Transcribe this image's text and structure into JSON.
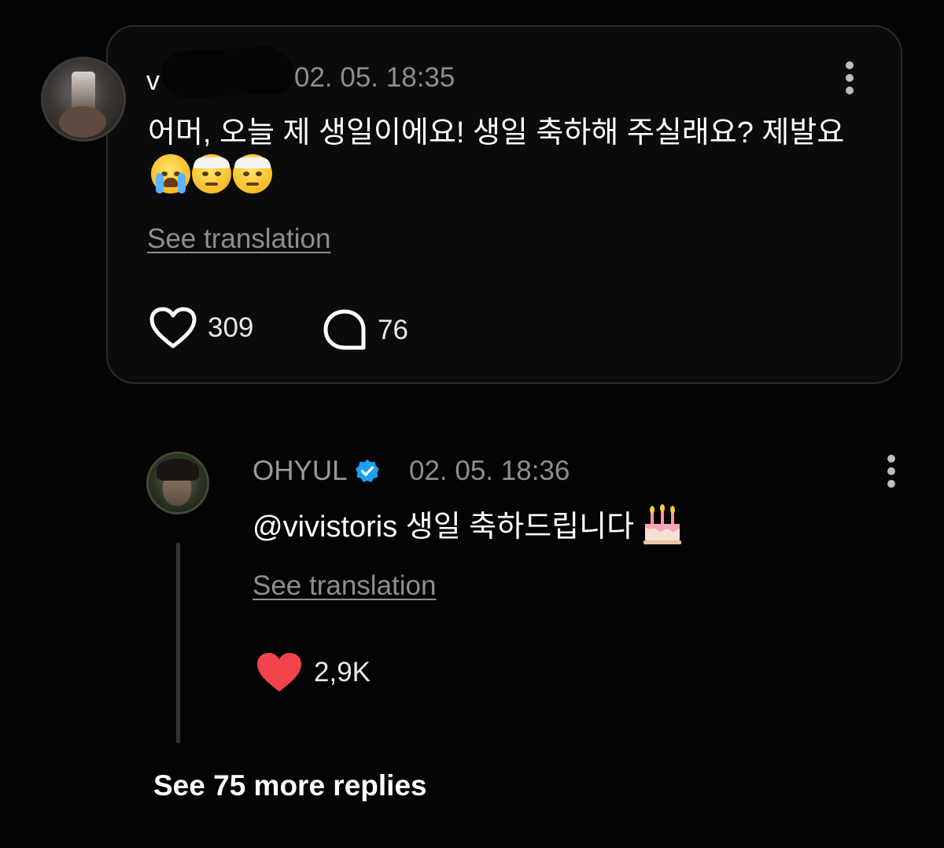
{
  "comment": {
    "username": "v",
    "timestamp": "02. 05. 18:35",
    "text": "어머, 오늘 제 생일이에요! 생일 축하해 주실래요? 제발요",
    "emojis": [
      "loudly-crying-face",
      "face-with-head-bandage",
      "face-with-head-bandage"
    ],
    "see_translation": "See translation",
    "likes": "309",
    "replies": "76",
    "like_icon": "heart-outline-icon",
    "reply_icon": "speech-bubble-icon"
  },
  "reply": {
    "username": "OHYUL",
    "verified_icon": "verified-badge-icon",
    "verified_color": "#1da1f2",
    "timestamp": "02. 05. 18:36",
    "text": "@vivistoris 생일 축하드립니다",
    "emoji": "birthday-cake",
    "see_translation": "See translation",
    "likes": "2,9K",
    "liked": true,
    "like_color": "#f4424d"
  },
  "footer": {
    "see_more": "See 75 more replies"
  },
  "colors": {
    "background": "#040404",
    "card": "#0b0b0b",
    "muted_text": "#8e8e8e"
  }
}
